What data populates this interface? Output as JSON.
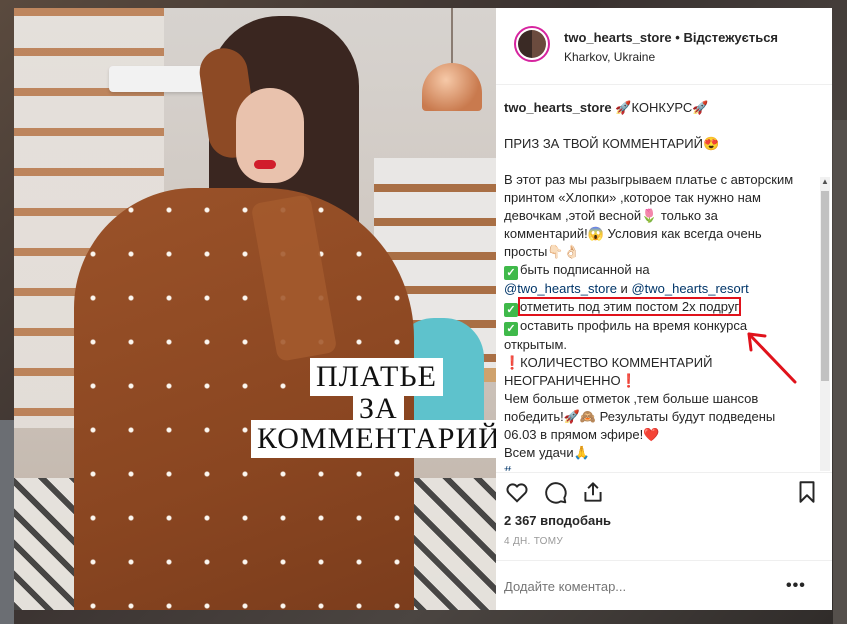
{
  "post": {
    "header": {
      "username": "two_hearts_store",
      "separator": "•",
      "follow_label": "Відстежується",
      "location": "Kharkov, Ukraine"
    },
    "image_caption": [
      "ПЛАТЬЕ",
      "ЗА",
      "КОММЕНТАРИЙ"
    ],
    "caption": {
      "username": "two_hearts_store",
      "title": "🚀КОНКУРС🚀",
      "prize_line": "ПРИЗ ЗА ТВОЙ КОММЕНТАРИЙ😍",
      "body_1": "В этот раз мы разыгрываем платье с авторским принтом «Хлопки» ,которое так нужно нам девочкам ,этой весной🌷 только за комментарий!😱 Условия как всегда очень просты👇🏻👌🏻",
      "rule_1_prefix": "быть подписанной на",
      "mention_1": "@two_hearts_store",
      "and_word": "и",
      "mention_2": "@two_hearts_resort",
      "rule_2": "отметить под этим постом 2х подруг",
      "rule_3": "оставить профиль на время конкурса открытым.",
      "unlimited": "❗КОЛИЧЕСТВО КОММЕНТАРИЙ НЕОГРАНИЧЕННО❗",
      "body_2": "Чем больше отметок ,тем больше шансов победить!🚀🙈 Результаты будут подведены 06.03 в прямом эфире!❤️",
      "good_luck": "Всем удачи🙏",
      "hashtags": "#..."
    },
    "likes": "2 367 вподобань",
    "time_ago": "4 ДН. ТОМУ",
    "comment_placeholder": "Додайте коментар...",
    "more_label": "•••"
  },
  "colors": {
    "highlight": "#e0121b",
    "link": "#003569",
    "check": "#3fb94a"
  }
}
